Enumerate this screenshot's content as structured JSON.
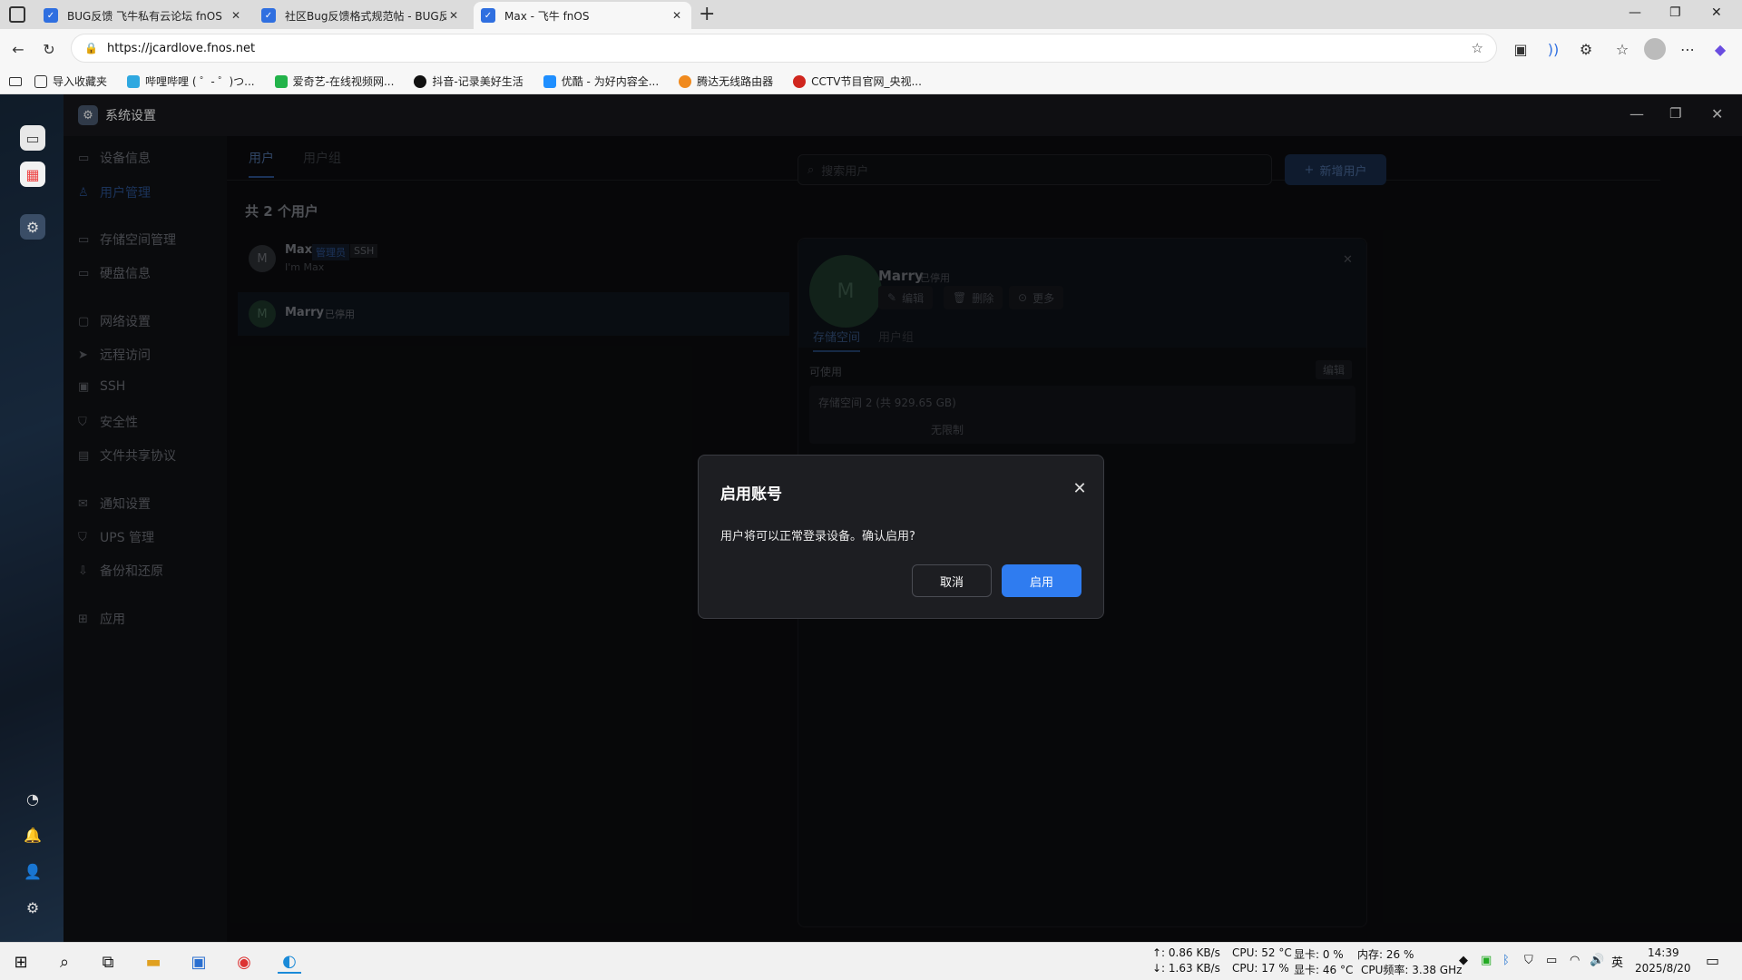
{
  "browser": {
    "tabs": [
      {
        "label": "BUG反馈 飞牛私有云论坛 fnOS",
        "close": "✕"
      },
      {
        "label": "社区Bug反馈格式规范帖 - BUG反",
        "close": "✕"
      },
      {
        "label": "Max - 飞牛 fnOS",
        "close": "✕"
      }
    ],
    "new_tab": "+",
    "url": "https://jcardlove.fnos.net",
    "bookmarks": [
      "导入收藏夹",
      "哔哩哔哩 ( ゜- ゜)つ...",
      "爱奇艺-在线视频网...",
      "抖音-记录美好生活",
      "优酷 - 为好内容全...",
      "腾达无线路由器",
      "CCTV节目官网_央视..."
    ],
    "window_controls": {
      "minimize": "—",
      "restore": "❐",
      "close": "✕"
    }
  },
  "fnos": {
    "title": "系统设置",
    "sidebar": [
      {
        "label": "设备信息",
        "icon": "device-icon"
      },
      {
        "label": "用户管理",
        "icon": "user-icon"
      },
      {
        "label": "存储空间管理",
        "icon": "storage-icon"
      },
      {
        "label": "硬盘信息",
        "icon": "disk-icon"
      },
      {
        "label": "网络设置",
        "icon": "network-icon"
      },
      {
        "label": "远程访问",
        "icon": "remote-icon"
      },
      {
        "label": "SSH",
        "icon": "ssh-icon"
      },
      {
        "label": "安全性",
        "icon": "shield-icon"
      },
      {
        "label": "文件共享协议",
        "icon": "file-share-icon"
      },
      {
        "label": "通知设置",
        "icon": "mail-icon"
      },
      {
        "label": "UPS 管理",
        "icon": "ups-icon"
      },
      {
        "label": "备份和还原",
        "icon": "backup-icon"
      },
      {
        "label": "应用",
        "icon": "apps-icon"
      }
    ],
    "tabs": [
      "用户",
      "用户组"
    ],
    "user_count": "共 2 个用户",
    "search_placeholder": "搜索用户",
    "add_user": "新增用户",
    "users": [
      {
        "avatar": "M",
        "name": "Max",
        "badge1": "管理员",
        "badge2": "SSH",
        "subtitle": "I'm Max"
      },
      {
        "avatar": "M",
        "name": "Marry",
        "badge1": "已停用"
      }
    ],
    "detail": {
      "avatar": "M",
      "name": "Marry",
      "status": "已停用",
      "actions": [
        "编辑",
        "删除",
        "更多"
      ],
      "tabs": [
        "存储空间",
        "用户组"
      ],
      "available_label": "可使用",
      "edit": "编辑",
      "storage_name": "存储空间 2 (共 929.65 GB)",
      "limit": "无限制"
    }
  },
  "dialog": {
    "title": "启用账号",
    "close": "✕",
    "message": "用户将可以正常登录设备。确认启用?",
    "cancel": "取消",
    "confirm": "启用"
  },
  "taskbar": {
    "net_up": "↑: 0.86 KB/s",
    "net_down": "↓: 1.63 KB/s",
    "cpu_temp": "CPU: 52 °C",
    "gpu_usage": "显卡: 0 %",
    "mem": "内存: 26 %",
    "cpu_usage": "CPU: 17 %",
    "gpu_temp": "显卡: 46 °C",
    "cpu_freq": "CPU频率: 3.38 GHz",
    "ime": "英",
    "time": "14:39",
    "date": "2025/8/20"
  },
  "colors": {
    "accent": "#2f7cf0",
    "dialog_bg": "#1d1e22",
    "window_bg": "#0e0f12"
  }
}
